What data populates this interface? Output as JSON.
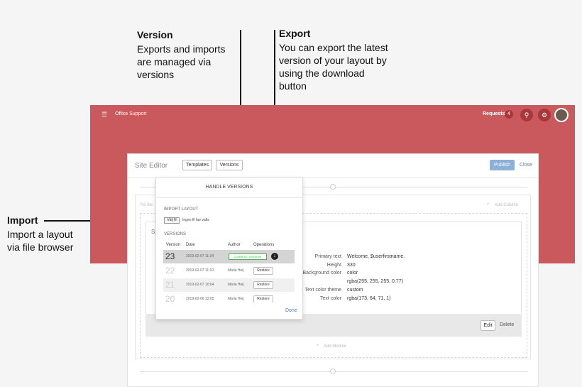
{
  "annotations": {
    "version": {
      "title": "Version",
      "lines": [
        "Exports and imports",
        "are managed via",
        "versions"
      ]
    },
    "export": {
      "title": "Export",
      "lines": [
        "You can export the latest",
        "version of your layout by",
        "using the download",
        "button"
      ]
    },
    "import": {
      "title": "Import",
      "lines": [
        "Import a layout",
        "via file browser"
      ]
    }
  },
  "topbar": {
    "menu_icon": "hamburger-icon",
    "app_title": "Office Support",
    "requests_label": "Requests",
    "requests_count": "4",
    "search_icon": "search-icon",
    "settings_icon": "gear-icon"
  },
  "editor": {
    "title": "Site Editor",
    "templates_label": "Templates",
    "versions_label": "Versions",
    "publish_label": "Publish",
    "close_label": "Close",
    "add_column_label": "Add Column",
    "add_module_label": "Add Module",
    "left_faint": "No tile",
    "card_letter": "S",
    "edit_label": "Edit",
    "delete_label": "Delete"
  },
  "properties": [
    {
      "label": "Primary text",
      "value": "Welcome, $userfirstname."
    },
    {
      "label": "Height",
      "value": "330"
    },
    {
      "label": "Background color",
      "value": "color"
    },
    {
      "label": "",
      "value": "rgba(255, 255, 255, 0.77)"
    },
    {
      "label": "Text color theme",
      "value": "custom"
    },
    {
      "label": "Text color",
      "value": "rgba(173, 64, 71, 1)"
    }
  ],
  "versions_panel": {
    "heading": "HANDLE VERSIONS",
    "import_label": "IMPORT LAYOUT",
    "file_button": "Välj fil",
    "file_status": "Ingen fil har valts",
    "versions_label": "VERSIONS",
    "columns": [
      "Version",
      "Date",
      "Author",
      "Operations"
    ],
    "rows": [
      {
        "version": "23",
        "date": "2019-02-07 11:34",
        "author": "",
        "status": "CURRENT VERSION",
        "action": ""
      },
      {
        "version": "22",
        "date": "2019-02-07 11:10",
        "author": "Maria Heij",
        "status": "",
        "action": "Restore"
      },
      {
        "version": "21",
        "date": "2019-02-07 10:04",
        "author": "Maria Heij",
        "status": "",
        "action": "Restore"
      },
      {
        "version": "20",
        "date": "2019-02-06 13:05",
        "author": "Maria Heij",
        "status": "",
        "action": "Restore"
      }
    ],
    "done_label": "Done"
  },
  "colors": {
    "hero": "#c9595c",
    "accent_blue": "#4a7bbd",
    "current_green": "#4caf50"
  }
}
